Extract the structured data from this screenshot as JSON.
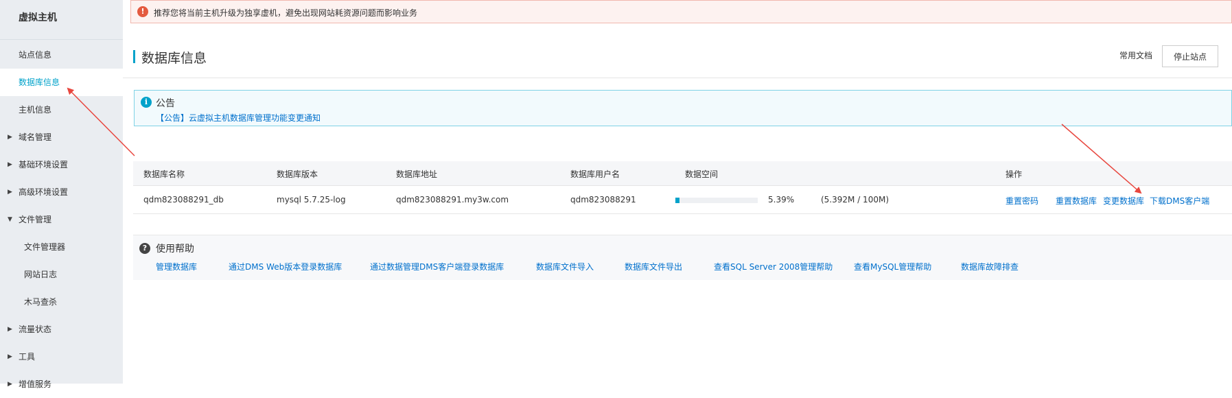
{
  "sidebar": {
    "title": "虚拟主机",
    "items": [
      {
        "label": "站点信息"
      },
      {
        "label": "数据库信息"
      },
      {
        "label": "主机信息"
      },
      {
        "label": "域名管理",
        "caret": "▶"
      },
      {
        "label": "基础环境设置",
        "caret": "▶"
      },
      {
        "label": "高级环境设置",
        "caret": "▶"
      },
      {
        "label": "文件管理",
        "caret": "▼"
      },
      {
        "label": "文件管理器"
      },
      {
        "label": "网站日志"
      },
      {
        "label": "木马查杀"
      },
      {
        "label": "流量状态",
        "caret": "▶"
      },
      {
        "label": "工具",
        "caret": "▶"
      },
      {
        "label": "增值服务",
        "caret": "▶"
      }
    ]
  },
  "alert": {
    "icon": "!",
    "text": "推荐您将当前主机升级为独享虚机，避免出现网站耗资源问题而影响业务"
  },
  "header": {
    "title": "数据库信息",
    "docs_link": "常用文档",
    "stop_button": "停止站点"
  },
  "notice": {
    "icon": "i",
    "title": "公告",
    "link": "【公告】云虚拟主机数据库管理功能变更通知"
  },
  "table": {
    "headers": [
      "数据库名称",
      "数据库版本",
      "数据库地址",
      "数据库用户名",
      "数据空间",
      "操作"
    ],
    "row": {
      "name": "qdm823088291_db",
      "version": "mysql 5.7.25-log",
      "address": "qdm823088291.my3w.com",
      "username": "qdm823088291",
      "usage_percent": 5.39,
      "usage_text": "5.39%",
      "usage_detail": "(5.392M / 100M)",
      "actions": [
        "重置密码",
        "重置数据库",
        "变更数据库",
        "下载DMS客户端"
      ]
    }
  },
  "help": {
    "icon": "?",
    "title": "使用帮助",
    "links": [
      "管理数据库",
      "通过DMS Web版本登录数据库",
      "通过数据管理DMS客户端登录数据库",
      "数据库文件导入",
      "数据库文件导出",
      "查看SQL Server 2008管理帮助",
      "查看MySQL管理帮助",
      "数据库故障排查"
    ]
  },
  "colors": {
    "accent": "#00a2ca",
    "link": "#0070cc",
    "warning": "#e45a3f",
    "annotation_arrow": "#e8473f"
  }
}
